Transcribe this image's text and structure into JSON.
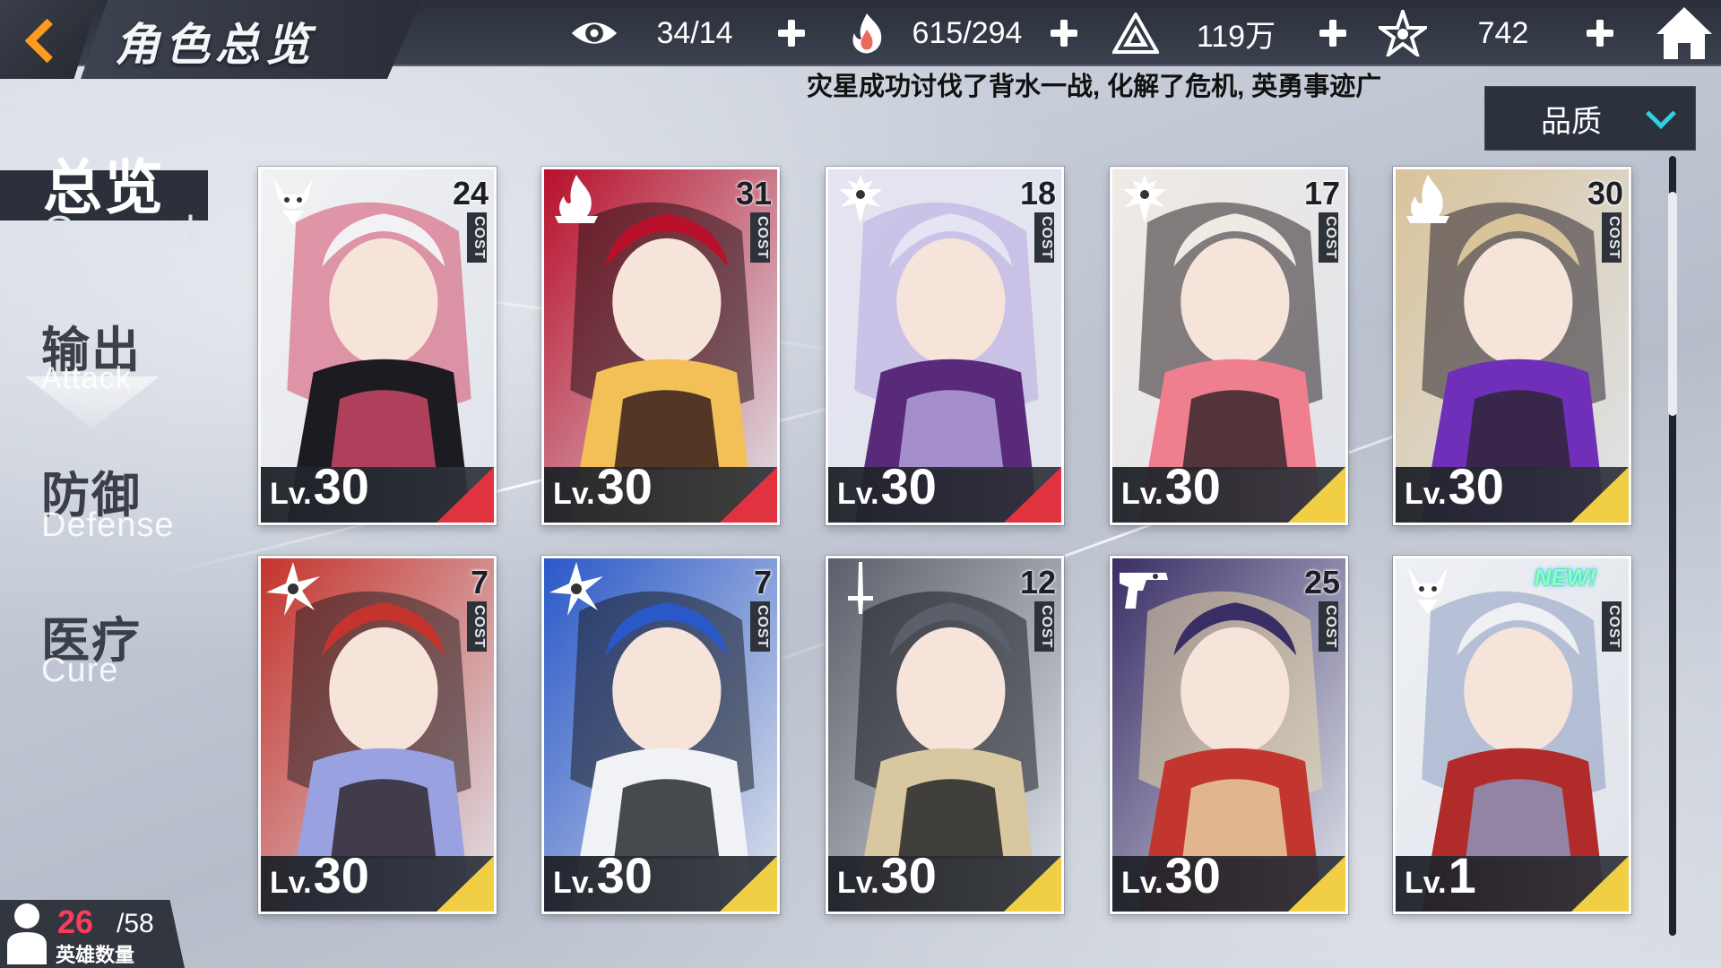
{
  "header": {
    "title": "角色总览",
    "resources": [
      {
        "name": "stamina",
        "icon": "eye-icon",
        "value": "34/14"
      },
      {
        "name": "energy",
        "icon": "flame-hand-icon",
        "value": "615/294"
      },
      {
        "name": "gold",
        "icon": "triangle-crystal-icon",
        "value": "119万"
      },
      {
        "name": "stars",
        "icon": "star-burst-icon",
        "value": "742"
      }
    ]
  },
  "marquee": {
    "text": "灾星成功讨伐了背水一战, 化解了危机, 英勇事迹广"
  },
  "sort": {
    "label": "品质"
  },
  "categories": [
    {
      "zh": "总览",
      "en": "General"
    },
    {
      "zh": "输出",
      "en": "Attack"
    },
    {
      "zh": "防御",
      "en": "Defense"
    },
    {
      "zh": "医疗",
      "en": "Cure"
    }
  ],
  "cards": [
    {
      "cost": "24",
      "cost_word": "COST",
      "lv_prefix": "Lv.",
      "level": "30",
      "cls_icon": "horned-demon-icon",
      "rarity": "#e0333f",
      "palette": [
        "#f2f2f4",
        "#1d1b22",
        "#d44a6a"
      ]
    },
    {
      "cost": "31",
      "cost_word": "COST",
      "lv_prefix": "Lv.",
      "level": "30",
      "cls_icon": "flame-icon",
      "rarity": "#e0333f",
      "palette": [
        "#b8102a",
        "#f2c057",
        "#2a1418"
      ]
    },
    {
      "cost": "18",
      "cost_word": "COST",
      "lv_prefix": "Lv.",
      "level": "30",
      "cls_icon": "winged-crest-icon",
      "rarity": "#e0333f",
      "palette": [
        "#e5e4f2",
        "#5a2a7a",
        "#b6a7e0"
      ]
    },
    {
      "cost": "17",
      "cost_word": "COST",
      "lv_prefix": "Lv.",
      "level": "30",
      "cls_icon": "winged-crest-icon",
      "rarity": "#f1cf45",
      "palette": [
        "#f0eae5",
        "#ef7f8e",
        "#2b2226"
      ]
    },
    {
      "cost": "30",
      "cost_word": "COST",
      "lv_prefix": "Lv.",
      "level": "30",
      "cls_icon": "flame-icon",
      "rarity": "#f1cf45",
      "palette": [
        "#d9c39a",
        "#6f2fb8",
        "#2a2530"
      ]
    },
    {
      "cost": "7",
      "cost_word": "COST",
      "lv_prefix": "Lv.",
      "level": "30",
      "cls_icon": "shuriken-icon",
      "rarity": "#f1cf45",
      "palette": [
        "#c5342c",
        "#9aa1e0",
        "#2b2226"
      ]
    },
    {
      "cost": "7",
      "cost_word": "COST",
      "lv_prefix": "Lv.",
      "level": "30",
      "cls_icon": "shuriken-icon",
      "rarity": "#f1cf45",
      "palette": [
        "#2a58c8",
        "#f0f2f5",
        "#1c1f26"
      ]
    },
    {
      "cost": "12",
      "cost_word": "COST",
      "lv_prefix": "Lv.",
      "level": "30",
      "cls_icon": "sword-icon",
      "rarity": "#f1cf45",
      "palette": [
        "#5b5f69",
        "#d8c7a0",
        "#1b1d22"
      ]
    },
    {
      "cost": "25",
      "cost_word": "COST",
      "lv_prefix": "Lv.",
      "level": "30",
      "cls_icon": "pistol-icon",
      "rarity": "#f1cf45",
      "palette": [
        "#3a2e66",
        "#c2362f",
        "#e9d7a8"
      ]
    },
    {
      "cost": "",
      "cost_word": "COST",
      "lv_prefix": "Lv.",
      "level": "1",
      "cls_icon": "horned-demon-icon",
      "rarity": "#f1cf45",
      "palette": [
        "#eef0f4",
        "#b22b2b",
        "#8a9bc0"
      ],
      "badge": "NEW!"
    }
  ],
  "hero_count": {
    "current": "26",
    "max": "/58",
    "label": "英雄数量"
  }
}
